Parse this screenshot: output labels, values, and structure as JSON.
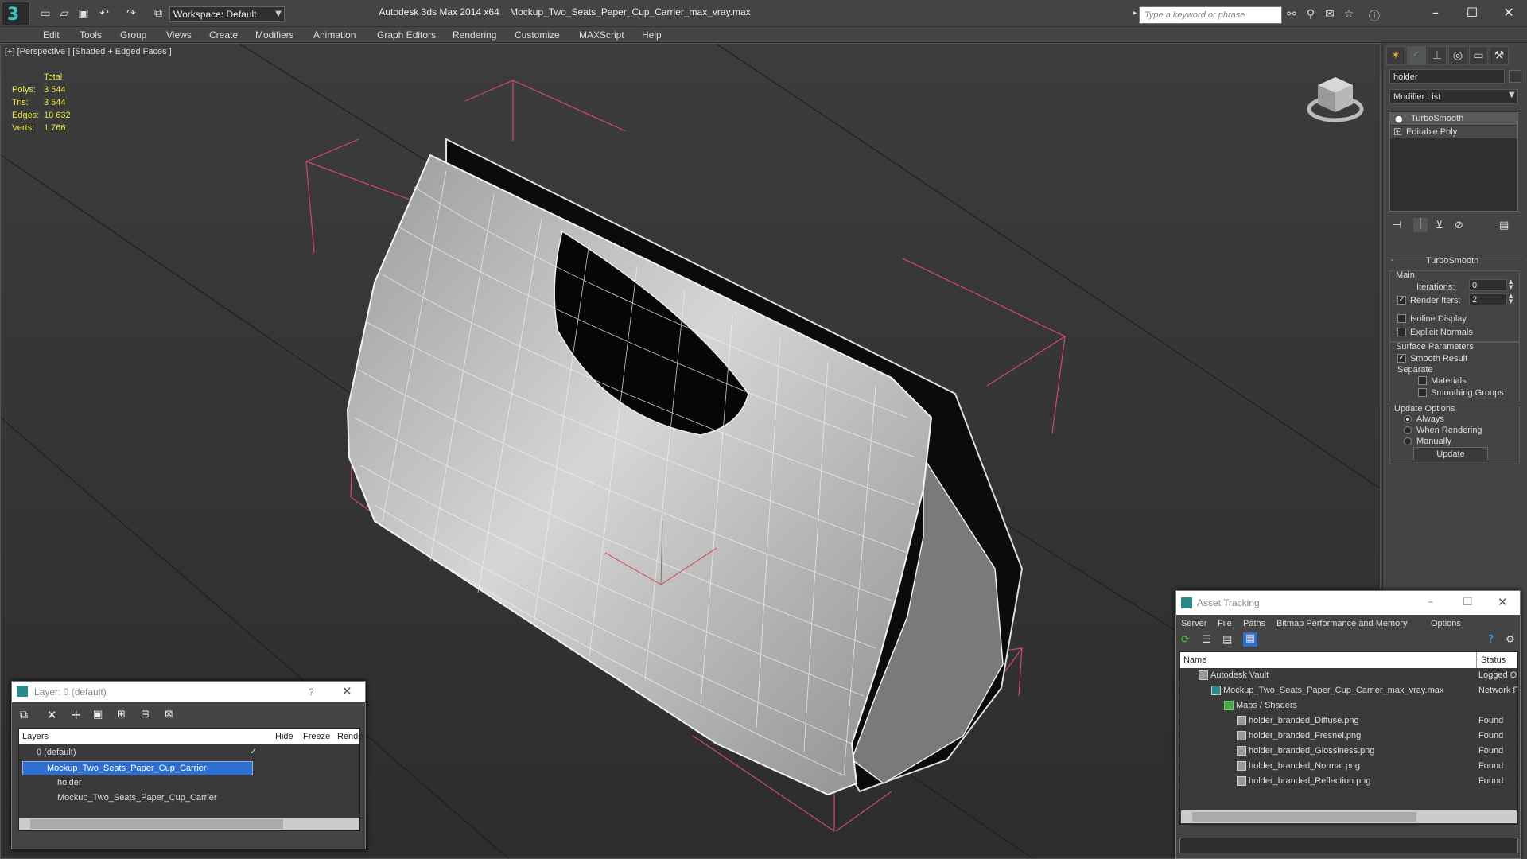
{
  "titlebar": {
    "app": "Autodesk 3ds Max  2014 x64",
    "file": "Mockup_Two_Seats_Paper_Cup_Carrier_max_vray.max",
    "workspace": "Workspace: Default",
    "search_placeholder": "Type a keyword or phrase"
  },
  "menu": [
    "Edit",
    "Tools",
    "Group",
    "Views",
    "Create",
    "Modifiers",
    "Animation",
    "Graph Editors",
    "Rendering",
    "Customize",
    "MAXScript",
    "Help"
  ],
  "viewport": {
    "label": "[+] [Perspective ] [Shaded + Edged Faces ]",
    "stats": {
      "header": "Total",
      "rows": [
        {
          "label": "Polys:",
          "value": "3 544"
        },
        {
          "label": "Tris:",
          "value": "3 544"
        },
        {
          "label": "Edges:",
          "value": "10 632"
        },
        {
          "label": "Verts:",
          "value": "1 766"
        }
      ]
    }
  },
  "command_panel": {
    "object_name": "holder",
    "modifier_list": "Modifier List",
    "stack": [
      "TurboSmooth",
      "Editable Poly"
    ],
    "rollout_title": "TurboSmooth",
    "main_label": "Main",
    "iterations_label": "Iterations:",
    "iterations_value": "0",
    "render_iters_label": "Render Iters:",
    "render_iters_value": "2",
    "isoline": "Isoline Display",
    "explicit_normals": "Explicit Normals",
    "surface_params": "Surface Parameters",
    "smooth_result": "Smooth Result",
    "separate": "Separate",
    "materials": "Materials",
    "smoothing_groups": "Smoothing Groups",
    "update_options": "Update Options",
    "always": "Always",
    "when_rendering": "When Rendering",
    "manually": "Manually",
    "update_btn": "Update"
  },
  "layer_dialog": {
    "title": "Layer: 0 (default)",
    "help": "?",
    "columns": [
      "Layers",
      "Hide",
      "Freeze",
      "Rende"
    ],
    "rows": [
      "0 (default)",
      "Mockup_Two_Seats_Paper_Cup_Carrier",
      "holder",
      "Mockup_Two_Seats_Paper_Cup_Carrier"
    ]
  },
  "asset_tracking": {
    "title": "Asset Tracking",
    "menu": [
      "Server",
      "File",
      "Paths",
      "Bitmap Performance and Memory",
      "Options"
    ],
    "columns": [
      "Name",
      "Status"
    ],
    "rows": [
      {
        "name": "Autodesk Vault",
        "status": "Logged O"
      },
      {
        "name": "Mockup_Two_Seats_Paper_Cup_Carrier_max_vray.max",
        "status": "Network F"
      },
      {
        "name": "Maps / Shaders",
        "status": ""
      },
      {
        "name": "holder_branded_Diffuse.png",
        "status": "Found"
      },
      {
        "name": "holder_branded_Fresnel.png",
        "status": "Found"
      },
      {
        "name": "holder_branded_Glossiness.png",
        "status": "Found"
      },
      {
        "name": "holder_branded_Normal.png",
        "status": "Found"
      },
      {
        "name": "holder_branded_Reflection.png",
        "status": "Found"
      }
    ]
  }
}
